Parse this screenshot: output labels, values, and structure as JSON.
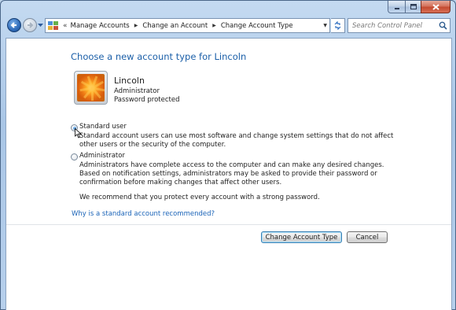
{
  "window": {
    "caption_buttons": [
      "minimize",
      "maximize",
      "close"
    ]
  },
  "nav": {
    "back_icon": "back-arrow-icon",
    "forward_icon": "forward-arrow-icon",
    "history_icon": "chevron-down-icon"
  },
  "address_bar": {
    "overflow": "«",
    "crumbs": [
      "Manage Accounts",
      "Change an Account",
      "Change Account Type"
    ]
  },
  "search": {
    "placeholder": "Search Control Panel"
  },
  "page": {
    "heading": "Choose a new account type for Lincoln",
    "account": {
      "name": "Lincoln",
      "type": "Administrator",
      "password_status": "Password protected"
    },
    "options": [
      {
        "label": "Standard user",
        "checked": true,
        "description": "Standard account users can use most software and change system settings that do not affect other users or the security of the computer."
      },
      {
        "label": "Administrator",
        "checked": false,
        "description": "Administrators have complete access to the computer and can make any desired changes. Based on notification settings, administrators may be asked to provide their password or confirmation before making changes that affect other users.",
        "note": "We recommend that you protect every account with a strong password."
      }
    ],
    "help_link": "Why is a standard account recommended?",
    "buttons": {
      "primary": "Change Account Type",
      "cancel": "Cancel"
    }
  },
  "colors": {
    "heading": "#1b5fa8",
    "link": "#1b64b8",
    "frame": "#b7d0ec"
  }
}
